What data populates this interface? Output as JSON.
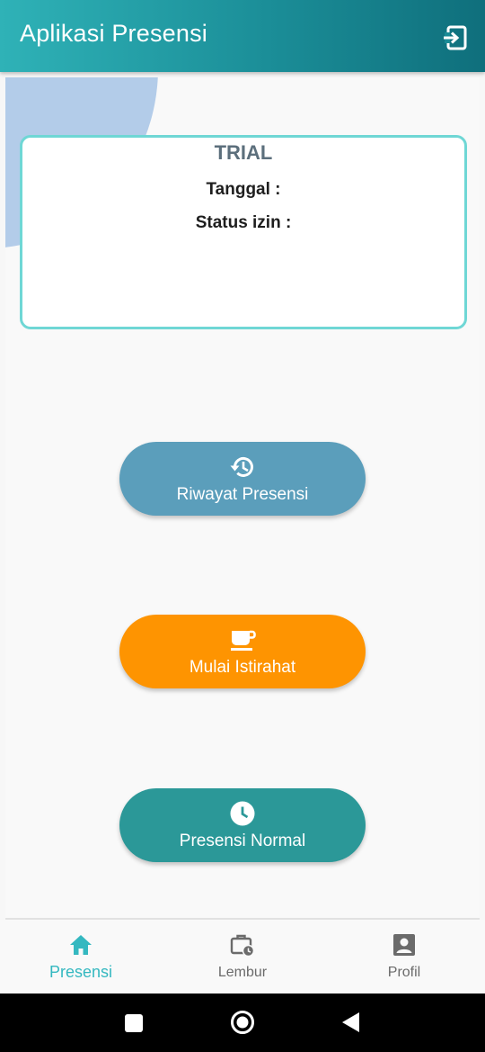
{
  "app_bar": {
    "title": "Aplikasi Presensi",
    "logout_icon": "logout-icon"
  },
  "info_card": {
    "title": "TRIAL",
    "date_label": "Tanggal  :",
    "status_label": "Status izin :"
  },
  "actions": {
    "history": {
      "label": "Riwayat Presensi",
      "icon": "history-icon",
      "color": "#5b9ebb"
    },
    "break": {
      "label": "Mulai Istirahat",
      "icon": "coffee-icon",
      "color": "#fe9401"
    },
    "normal": {
      "label": "Presensi Normal",
      "icon": "clock-icon",
      "color": "#2b9898"
    }
  },
  "bottom_nav": {
    "items": [
      {
        "label": "Presensi",
        "icon": "home-icon",
        "active": true
      },
      {
        "label": "Lembur",
        "icon": "work-history-icon",
        "active": false
      },
      {
        "label": "Profil",
        "icon": "account-box-icon",
        "active": false
      }
    ]
  },
  "colors": {
    "primary": "#2b9898",
    "accent": "#34b8c0",
    "card_border": "#6fd7d5",
    "blob": "#b3cce9"
  },
  "system_nav": {
    "recents_icon": "square-icon",
    "home_icon": "circle-icon",
    "back_icon": "triangle-back-icon"
  }
}
